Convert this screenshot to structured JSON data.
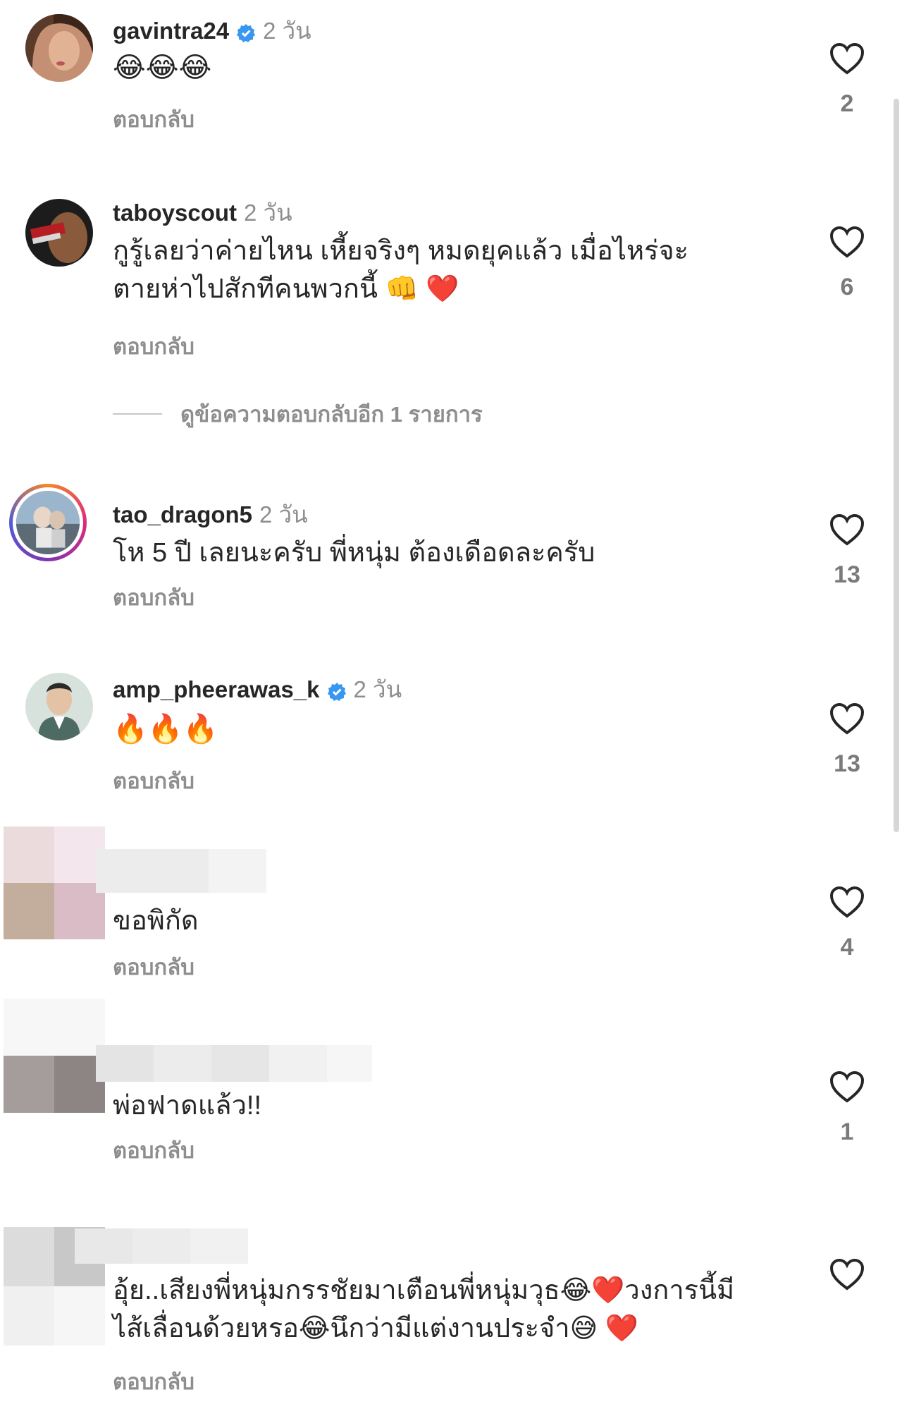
{
  "reply_label": "ตอบกลับ",
  "comments": [
    {
      "username": "gavintra24",
      "verified": true,
      "time": "2 วัน",
      "text": "😂😂😂",
      "likes": "2"
    },
    {
      "username": "taboyscout",
      "verified": false,
      "time": "2 วัน",
      "text_line1": "กูรู้เลยว่าค่ายไหน เหี้ยจริงๆ หมดยุคแล้ว เมื่อไหร่จะ",
      "text_line2": "ตายห่าไปสักทีคนพวกนี้ 👊 ❤️",
      "likes": "6",
      "view_replies": "ดูข้อความตอบกลับอีก 1 รายการ"
    },
    {
      "username": "tao_dragon5",
      "verified": false,
      "time": "2 วัน",
      "text": "โห 5 ปี เลยนะครับ พี่หนุ่ม ต้องเดือดละครับ",
      "likes": "13"
    },
    {
      "username": "amp_pheerawas_k",
      "verified": true,
      "time": "2 วัน",
      "text": "🔥🔥🔥",
      "likes": "13"
    },
    {
      "text": "ขอพิกัด",
      "likes": "4"
    },
    {
      "text": "พ่อฟาดแล้ว!!",
      "likes": "1"
    },
    {
      "text_line1": "อุ้ย..เสียงพี่หนุ่มกรรชัยมาเตือนพี่หนุ่มวุธ😂❤️วงการนี้มี",
      "text_line2": "ไส้เลื่อนด้วยหรอ😂นึกว่ามีแต่งานประจำ😅 ❤️"
    }
  ],
  "colors": {
    "text": "#262626",
    "secondary": "#8e8e8e",
    "verified": "#3897f0",
    "like_count": "#7a7a7a"
  },
  "icons": {
    "like": "heart-outline-icon",
    "verified": "verified-badge-icon"
  }
}
